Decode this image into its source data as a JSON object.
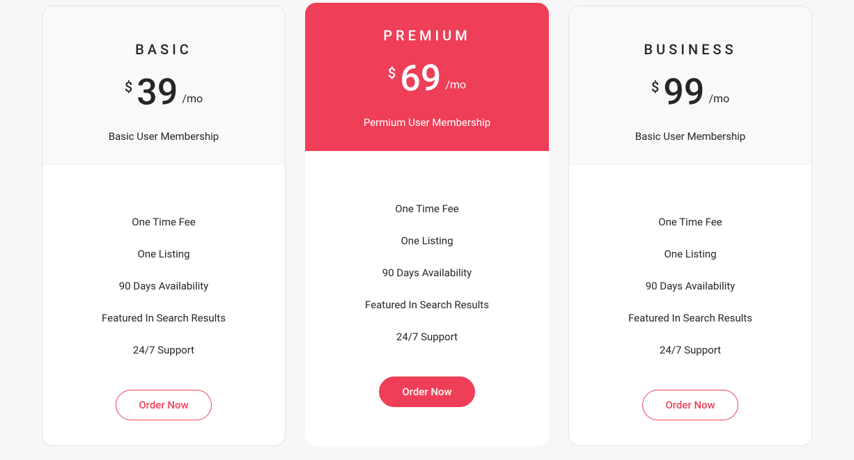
{
  "plans": [
    {
      "title": "BASIC",
      "currency": "$",
      "amount": "39",
      "period": "/mo",
      "subtitle": "Basic User Membership",
      "features": [
        "One Time Fee",
        "One Listing",
        "90 Days Availability",
        "Featured In Search Results",
        "24/7 Support"
      ],
      "cta": "Order Now"
    },
    {
      "title": "PREMIUM",
      "currency": "$",
      "amount": "69",
      "period": "/mo",
      "subtitle": "Permium User Membership",
      "features": [
        "One Time Fee",
        "One Listing",
        "90 Days Availability",
        "Featured In Search Results",
        "24/7 Support"
      ],
      "cta": "Order Now"
    },
    {
      "title": "BUSINESS",
      "currency": "$",
      "amount": "99",
      "period": "/mo",
      "subtitle": "Basic User Membership",
      "features": [
        "One Time Fee",
        "One Listing",
        "90 Days Availability",
        "Featured In Search Results",
        "24/7 Support"
      ],
      "cta": "Order Now"
    }
  ]
}
